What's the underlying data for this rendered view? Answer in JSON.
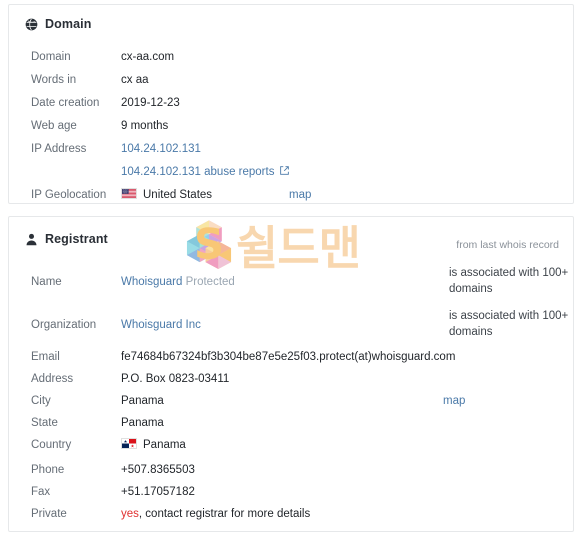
{
  "domain_card": {
    "title": "Domain",
    "icon": "globe-icon",
    "rows": [
      {
        "label": "Domain",
        "value": "cx-aa.com"
      },
      {
        "label": "Words in",
        "value": "cx aa"
      },
      {
        "label": "Date creation",
        "value": "2019-12-23"
      },
      {
        "label": "Web age",
        "value": "9 months"
      },
      {
        "label": "IP Address",
        "value": "104.24.102.131"
      },
      {
        "label": "",
        "value": "104.24.102.131 abuse reports"
      },
      {
        "label": "IP Geolocation",
        "value": "United States"
      }
    ],
    "ip_address": "104.24.102.131",
    "abuse_reports": "104.24.102.131 abuse reports",
    "geolocation": "United States",
    "geolocation_flag": "us-flag-icon",
    "external_link_icon": "external-link-icon",
    "map_label": "map"
  },
  "registrant_card": {
    "title": "Registrant",
    "icon": "user-icon",
    "note": "from last whois record",
    "rows": [
      {
        "label": "Name",
        "value": "Whoisguard Protected"
      },
      {
        "label": "Organization",
        "value": "Whoisguard Inc"
      },
      {
        "label": "Email",
        "value": "fe74684b67324bf3b304be87e5e25f03.protect(at)whoisguard.com"
      },
      {
        "label": "Address",
        "value": "P.O. Box 0823-03411"
      },
      {
        "label": "City",
        "value": "Panama"
      },
      {
        "label": "State",
        "value": "Panama"
      },
      {
        "label": "Country",
        "value": "Panama"
      },
      {
        "label": "Phone",
        "value": "+507.8365503"
      },
      {
        "label": "Fax",
        "value": "+51.17057182"
      },
      {
        "label": "Private",
        "value": "yes, contact registrar for more details"
      }
    ],
    "name_link": "Whoisguard",
    "name_suffix": "Protected",
    "organization_link": "Whoisguard Inc",
    "country_flag": "panama-flag-icon",
    "private_flag": "yes",
    "private_rest": ", contact registrar for more details",
    "map_label": "map",
    "assoc_name": "is associated with 100+ domains",
    "assoc_org": "is associated with 100+ domains"
  },
  "watermark": {
    "logo": "shieldman-s-logo",
    "text": "쉴드맨"
  },
  "colors": {
    "link": "#4a79a8",
    "muted": "#656d76",
    "danger": "#e03131",
    "border": "#e6e8ea"
  }
}
